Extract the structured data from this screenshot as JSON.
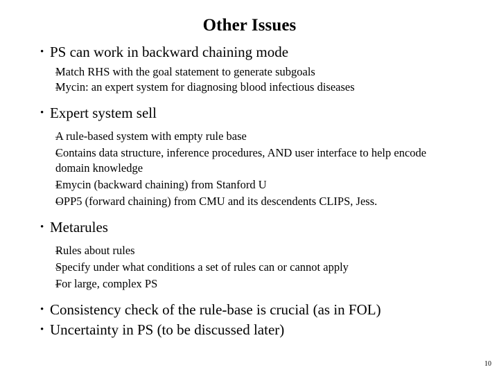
{
  "slide": {
    "title": "Other Issues",
    "page_number": "10",
    "bullet_marker_level1": "•",
    "bullet_marker_level2": "–",
    "blocks": [
      {
        "level1": "PS can work in backward chaining mode",
        "level2": [
          "Match RHS with the goal statement to generate subgoals",
          "Mycin: an expert system for diagnosing blood infectious diseases"
        ]
      },
      {
        "level1": "Expert system sell",
        "level2": [
          "A rule-based system with empty rule base",
          "Contains data structure, inference procedures, AND user interface to help encode domain knowledge",
          "Emycin (backward chaining) from Stanford U",
          "OPP5 (forward chaining) from CMU and its descendents CLIPS, Jess."
        ]
      },
      {
        "level1": "Metarules",
        "level2": [
          "Rules about rules",
          "Specify under what conditions a set of rules can or cannot apply",
          "For large, complex PS"
        ]
      },
      {
        "level1": "Consistency check of the rule-base is crucial (as in FOL)",
        "level2": []
      },
      {
        "level1": "Uncertainty in PS (to be discussed later)",
        "level2": []
      }
    ]
  }
}
